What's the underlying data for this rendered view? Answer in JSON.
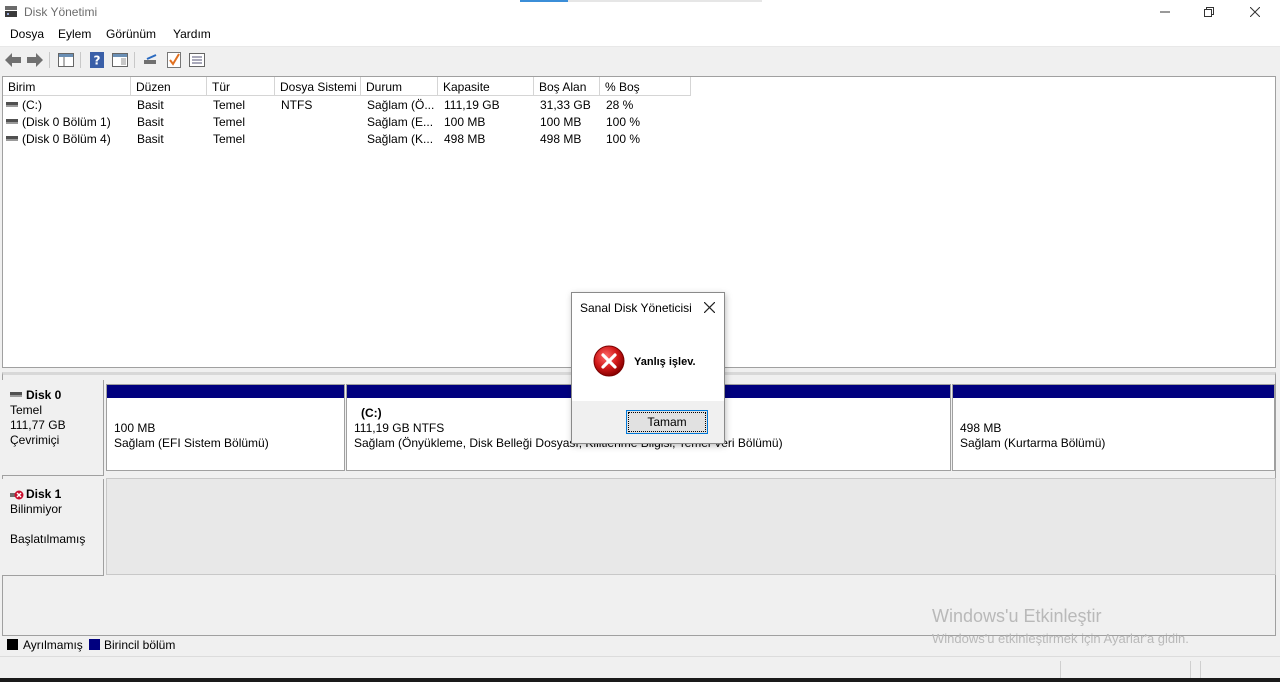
{
  "window": {
    "title": "Disk Yönetimi"
  },
  "menu": [
    "Dosya",
    "Eylem",
    "Görünüm",
    "Yardım"
  ],
  "columns": [
    "Birim",
    "Düzen",
    "Tür",
    "Dosya Sistemi",
    "Durum",
    "Kapasite",
    "Boş Alan",
    "% Boş"
  ],
  "volumes": [
    [
      "(C:)",
      "Basit",
      "Temel",
      "NTFS",
      "Sağlam (Ö...",
      "111,19 GB",
      "31,33 GB",
      "28 %"
    ],
    [
      "(Disk 0 Bölüm 1)",
      "Basit",
      "Temel",
      "",
      "Sağlam (E...",
      "100 MB",
      "100 MB",
      "100 %"
    ],
    [
      "(Disk 0 Bölüm 4)",
      "Basit",
      "Temel",
      "",
      "Sağlam (K...",
      "498 MB",
      "498 MB",
      "100 %"
    ]
  ],
  "disks": [
    {
      "name": "Disk 0",
      "type": "Temel",
      "size": "111,77 GB",
      "state": "Çevrimiçi"
    },
    {
      "name": "Disk 1",
      "type": "Bilinmiyor",
      "state": "Başlatılmamış"
    }
  ],
  "partitions": [
    {
      "label": "",
      "size": "100 MB",
      "status": "Sağlam (EFI Sistem Bölümü)"
    },
    {
      "label": "(C:)",
      "size": "111,19 GB NTFS",
      "status": "Sağlam (Önyükleme, Disk Belleği Dosyası, Kilitlenme Bilgisi, Temel Veri Bölümü)"
    },
    {
      "label": "",
      "size": "498 MB",
      "status": "Sağlam (Kurtarma Bölümü)"
    }
  ],
  "legend": [
    {
      "label": "Ayrılmamış",
      "color": "#000000"
    },
    {
      "label": "Birincil bölüm",
      "color": "#00007f"
    }
  ],
  "watermark": {
    "title": "Windows'u Etkinleştir",
    "subtitle": "Windows'u etkinleştirmek için Ayarlar'a gidin."
  },
  "dialog": {
    "title": "Sanal Disk Yöneticisi",
    "message": "Yanlış işlev.",
    "ok_label": "Tamam",
    "icon": "error-icon"
  }
}
